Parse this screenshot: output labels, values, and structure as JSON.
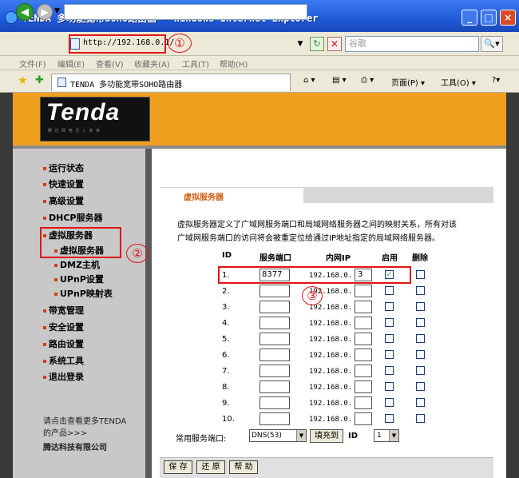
{
  "window": {
    "title": "TENDA 多功能宽带SOHO路由器 - Windows Internet Explorer",
    "min_label": "_",
    "max_label": "□",
    "close_label": "×"
  },
  "addressbar": {
    "url": "http://192.168.0.1/",
    "search_placeholder": "谷歌",
    "annotation": "①",
    "back_glyph": "◀",
    "forward_glyph": "▶",
    "dropdown_glyph": "▼",
    "go_glyph": "↻",
    "stop_glyph": "✕",
    "search_glyph": "🔍▾"
  },
  "menu": [
    "文件(F)",
    "编辑(E)",
    "查看(V)",
    "收藏夹(A)",
    "工具(T)",
    "帮助(H)"
  ],
  "tabbar": {
    "tab_label": "TENDA 多功能宽带SOHO路由器",
    "home_label": "⌂ ▾",
    "feed_label": "▤ ▾",
    "print_label": "⎙ ▾",
    "page_label": "页面(P) ▾",
    "tools_label": "工具(O) ▾",
    "help_label": "?▾",
    "star_glyph": "★",
    "add_glyph": "✚"
  },
  "brand": {
    "logo": "Tenda",
    "tagline": "腾 达 网 络 引 入 未 来"
  },
  "sidebar": {
    "items": [
      "运行状态",
      "快速设置",
      "高级设置",
      "DHCP服务器",
      "虚拟服务器"
    ],
    "subitems": [
      "虚拟服务器",
      "DMZ主机",
      "UPnP设置",
      "UPnP映射表"
    ],
    "items2": [
      "带宽管理",
      "安全设置",
      "路由设置",
      "系统工具",
      "退出登录"
    ],
    "annotation": "②",
    "footer_line1": "请点击查看更多TENDA",
    "footer_line2": "的产品>>>",
    "footer_company": "腾达科技有限公司"
  },
  "content": {
    "title": "虚拟服务器",
    "desc_line1": "虚拟服务器定义了广域网服务端口和局域网络服务器之间的映射关系，所有对该",
    "desc_line2": "广域网服务端口的访问将会被重定位给通过IP地址指定的局域网络服务器。",
    "headers": {
      "id": "ID",
      "port": "服务端口",
      "ip": "内网IP",
      "enable": "启用",
      "delete": "删除"
    },
    "ip_prefix": "192.168.0.",
    "annotation": "③",
    "check_glyph": "✓",
    "rows": [
      {
        "id": "1.",
        "port": "8377",
        "ip": "3",
        "enabled": true
      },
      {
        "id": "2.",
        "port": "",
        "ip": "",
        "enabled": false
      },
      {
        "id": "3.",
        "port": "",
        "ip": "",
        "enabled": false
      },
      {
        "id": "4.",
        "port": "",
        "ip": "",
        "enabled": false
      },
      {
        "id": "5.",
        "port": "",
        "ip": "",
        "enabled": false
      },
      {
        "id": "6.",
        "port": "",
        "ip": "",
        "enabled": false
      },
      {
        "id": "7.",
        "port": "",
        "ip": "",
        "enabled": false
      },
      {
        "id": "8.",
        "port": "",
        "ip": "",
        "enabled": false
      },
      {
        "id": "9.",
        "port": "",
        "ip": "",
        "enabled": false
      },
      {
        "id": "10.",
        "port": "",
        "ip": "",
        "enabled": false
      }
    ],
    "common_port_label": "常用服务端口:",
    "common_port_value": "DNS(53)",
    "fill_button": "填充到",
    "id_label": "ID",
    "id_value": "1",
    "select_arrow": "▼"
  },
  "buttons": {
    "save": "保 存",
    "restore": "还 原",
    "help": "帮 助"
  }
}
